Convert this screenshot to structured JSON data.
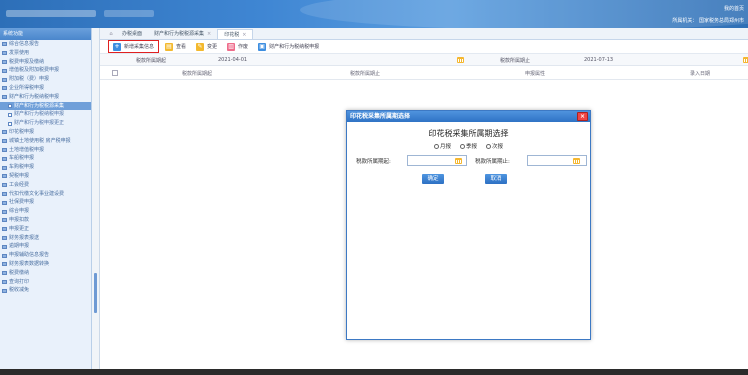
{
  "header": {
    "top_right_link": "我的首页",
    "agency_label": "所属机关：",
    "agency_value": "国家税务总局郑州市"
  },
  "sidebar": {
    "title": "系统功能",
    "items": [
      {
        "label": "综合信息报告",
        "level": 0
      },
      {
        "label": "发票使用",
        "level": 0
      },
      {
        "label": "税费申报及缴纳",
        "level": 0
      },
      {
        "label": "增值税及附加税费申报",
        "level": 0
      },
      {
        "label": "附加税（费）申报",
        "level": 0
      },
      {
        "label": "企业所得税申报",
        "level": 0
      },
      {
        "label": "财产和行为税纳税申报",
        "level": 0
      },
      {
        "label": "财产和行为税税源采集",
        "level": 1,
        "active": true
      },
      {
        "label": "财产和行为税纳税申报",
        "level": 1
      },
      {
        "label": "财产和行为税申报更正",
        "level": 1
      },
      {
        "label": "印花税申报",
        "level": 0
      },
      {
        "label": "城镇土地使用税 房产税申报",
        "level": 0
      },
      {
        "label": "土地增值税申报",
        "level": 0
      },
      {
        "label": "车船税申报",
        "level": 0
      },
      {
        "label": "车购税申报",
        "level": 0
      },
      {
        "label": "契税申报",
        "level": 0
      },
      {
        "label": "工会经费",
        "level": 0
      },
      {
        "label": "代扣代缴文化事业建设费",
        "level": 0
      },
      {
        "label": "社保费申报",
        "level": 0
      },
      {
        "label": "综合申报",
        "level": 0
      },
      {
        "label": "申报扣款",
        "level": 0
      },
      {
        "label": "申报更正",
        "level": 0
      },
      {
        "label": "财务报表报送",
        "level": 0
      },
      {
        "label": "逾期申报",
        "level": 0
      },
      {
        "label": "申报辅助信息报告",
        "level": 0
      },
      {
        "label": "财务报表数据转换",
        "level": 0
      },
      {
        "label": "税费缴纳",
        "level": 0
      },
      {
        "label": "查询打印",
        "level": 0
      },
      {
        "label": "税收减免",
        "level": 0
      }
    ]
  },
  "tabs": [
    {
      "label": "办税桌面",
      "closable": false
    },
    {
      "label": "财产和行为税税源采集",
      "closable": true
    },
    {
      "label": "印花税",
      "closable": true,
      "active": true
    }
  ],
  "toolbar": {
    "new_label": "新增采集信息",
    "view_label": "查看",
    "edit_label": "变更",
    "void_label": "作废",
    "declare_label": "财产和行为税纳税申报"
  },
  "filter": {
    "start_label": "税款所属期起",
    "start_value": "2021-04-01",
    "end_label": "税款所属期止",
    "end_value": "2021-07-13"
  },
  "table": {
    "columns": [
      "税款所属期起",
      "税款所属期止",
      "申报属性",
      "录入日期"
    ]
  },
  "modal": {
    "header": "印花税采集所属期选择",
    "title": "印花税采集所属期选择",
    "options": [
      "月报",
      "季报",
      "次报"
    ],
    "start_label": "税款所属期起:",
    "end_label": "税款所属期止:",
    "start_value": "",
    "end_value": "",
    "confirm_label": "确定",
    "cancel_label": "取消"
  },
  "colors": {
    "accent": "#3d79c4",
    "highlight_border": "#e02020",
    "close_button": "#e44444"
  }
}
